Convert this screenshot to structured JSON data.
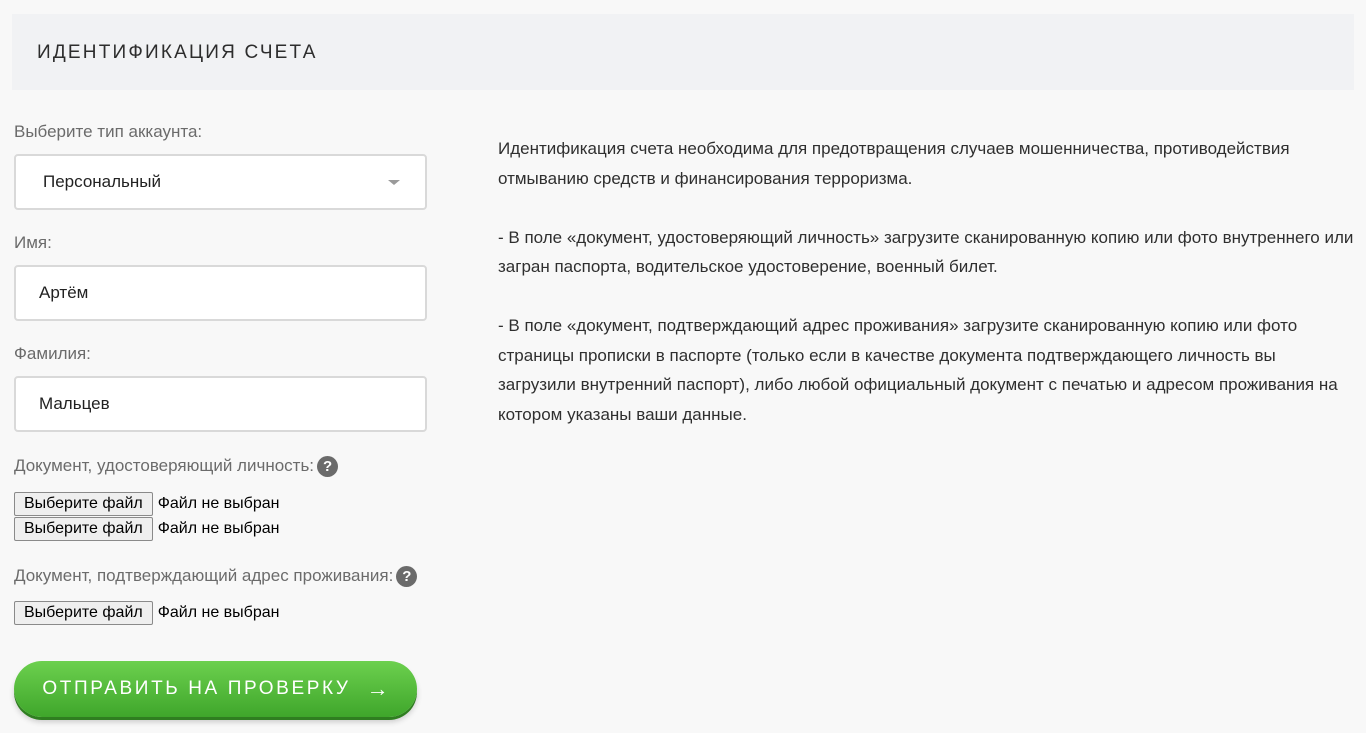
{
  "header": {
    "title": "ИДЕНТИФИКАЦИЯ СЧЕТА"
  },
  "form": {
    "account_type": {
      "label": "Выберите тип аккаунта:",
      "value": "Персональный"
    },
    "first_name": {
      "label": "Имя:",
      "value": "Артём"
    },
    "last_name": {
      "label": "Фамилия:",
      "value": "Мальцев"
    },
    "id_document": {
      "label": "Документ, удостоверяющий личность:",
      "files": [
        {
          "button": "Выберите файл",
          "status": "Файл не выбран"
        },
        {
          "button": "Выберите файл",
          "status": "Файл не выбран"
        }
      ]
    },
    "address_document": {
      "label": "Документ, подтверждающий адрес проживания:",
      "files": [
        {
          "button": "Выберите файл",
          "status": "Файл не выбран"
        }
      ]
    },
    "help_icon": "?",
    "submit_label": "ОТПРАВИТЬ НА ПРОВЕРКУ",
    "submit_arrow": "→"
  },
  "info": {
    "paragraphs": [
      "Идентификация счета необходима для предотвращения случаев мошенничества, противодействия отмыванию средств и финансирования терроризма.",
      "- В поле «документ, удостоверяющий личность» загрузите сканированную копию или фото внутреннего или загран паспорта, водительское удостоверение, военный билет.",
      "- В поле «документ, подтверждающий адрес проживания» загрузите сканированную копию или фото страницы прописки в паспорте (только если в качестве документа подтверждающего личность вы загрузили внутренний паспорт), либо любой официальный документ с печатью и адресом проживания на котором указаны ваши данные."
    ]
  },
  "icons": {
    "help": "help-icon",
    "dropdown": "chevron-down-icon",
    "submit": "arrow-right-icon"
  }
}
